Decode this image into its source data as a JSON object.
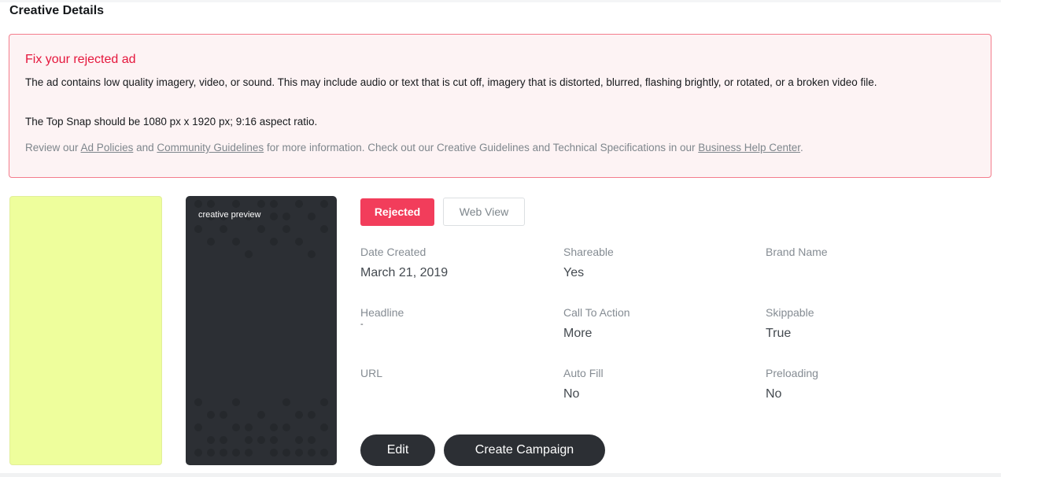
{
  "section": {
    "title": "Creative Details"
  },
  "alert": {
    "title": "Fix your rejected ad",
    "body": "The ad contains low quality imagery, video, or sound. This may include audio or text that is cut off, imagery that is distorted, blurred, flashing brightly, or rotated, or a broken video file.",
    "spec": "The Top Snap should be 1080 px x 1920 px; 9:16 aspect ratio.",
    "review_prefix": "Review our ",
    "link_ad_policies": "Ad Policies",
    "review_and": " and ",
    "link_community": "Community Guidelines",
    "review_middle": " for more information. Check out our Creative Guidelines and Technical Specifications in our ",
    "link_business": "Business Help Center",
    "review_suffix": "."
  },
  "preview": {
    "label": "creative preview"
  },
  "status": {
    "badge": "Rejected",
    "web_view": "Web View"
  },
  "details": {
    "date_created": {
      "label": "Date Created",
      "value": "March 21, 2019"
    },
    "shareable": {
      "label": "Shareable",
      "value": "Yes"
    },
    "brand_name": {
      "label": "Brand Name",
      "value": ""
    },
    "headline": {
      "label": "Headline",
      "value": "-"
    },
    "call_to_action": {
      "label": "Call To Action",
      "value": "More"
    },
    "skippable": {
      "label": "Skippable",
      "value": "True"
    },
    "url": {
      "label": "URL",
      "value": ""
    },
    "auto_fill": {
      "label": "Auto Fill",
      "value": "No"
    },
    "preloading": {
      "label": "Preloading",
      "value": "No"
    }
  },
  "actions": {
    "edit": "Edit",
    "create_campaign": "Create Campaign"
  },
  "colors": {
    "accent_red": "#f23d5b",
    "alert_title": "#e5163c",
    "alert_bg": "#fdf3f4",
    "preview_yellow": "#eefe9c",
    "dark": "#2c2f34"
  }
}
